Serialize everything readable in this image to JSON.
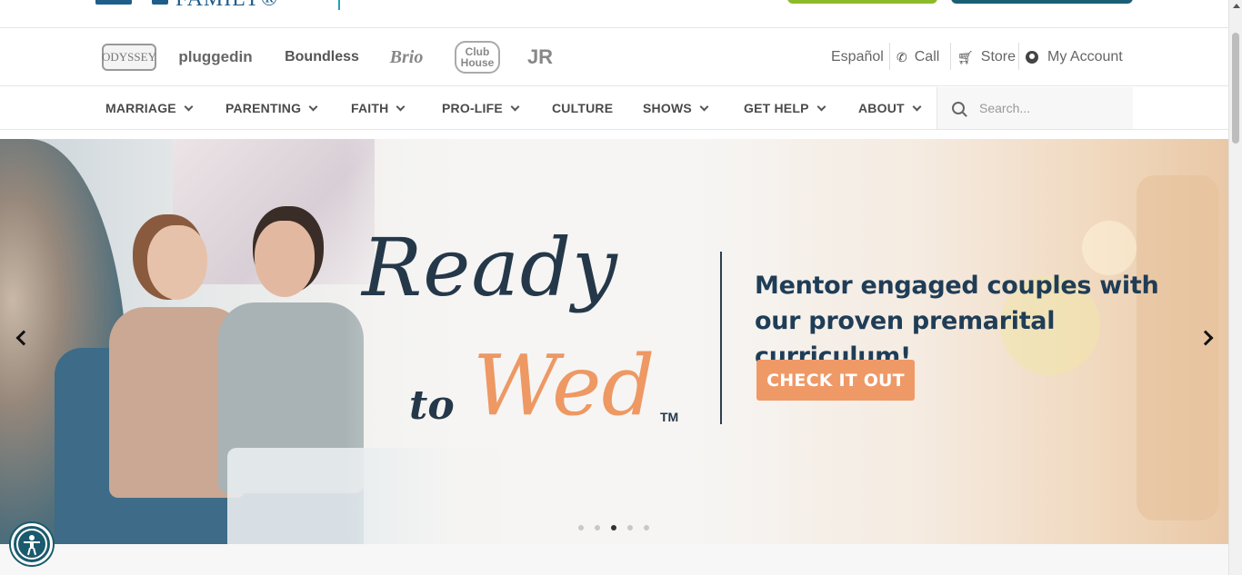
{
  "brand_links": [
    {
      "name": "Odyssey",
      "label": "ODYSSEY"
    },
    {
      "name": "Plugged In",
      "label": "pluggedin"
    },
    {
      "name": "Boundless",
      "label": "Boundless"
    },
    {
      "name": "Brio",
      "label": "Brio"
    },
    {
      "name": "Clubhouse",
      "label": "Club House"
    },
    {
      "name": "Clubhouse Jr",
      "label": "JR"
    }
  ],
  "utility_nav": {
    "espanol": "Español",
    "call": "Call",
    "store": "Store",
    "account": "My Account"
  },
  "main_nav": [
    {
      "label": "MARRIAGE",
      "has_dropdown": true
    },
    {
      "label": "PARENTING",
      "has_dropdown": true
    },
    {
      "label": "FAITH",
      "has_dropdown": true
    },
    {
      "label": "PRO-LIFE",
      "has_dropdown": true
    },
    {
      "label": "CULTURE",
      "has_dropdown": false
    },
    {
      "label": "SHOWS",
      "has_dropdown": true
    },
    {
      "label": "GET HELP",
      "has_dropdown": true
    },
    {
      "label": "ABOUT",
      "has_dropdown": true
    }
  ],
  "search": {
    "placeholder": "Search..."
  },
  "hero": {
    "title_line1": "Ready",
    "title_to": "to",
    "title_wed": "Wed",
    "trademark": "TM",
    "tagline_line1": "Mentor engaged couples with",
    "tagline_line2": "our proven premarital curriculum!",
    "cta": "CHECK IT OUT",
    "slide_count": 5,
    "active_slide": 3
  },
  "colors": {
    "accent_orange": "#ef9967",
    "navy": "#1f3d57",
    "green_button": "#8bbb2a",
    "teal_button": "#1a5f75"
  }
}
